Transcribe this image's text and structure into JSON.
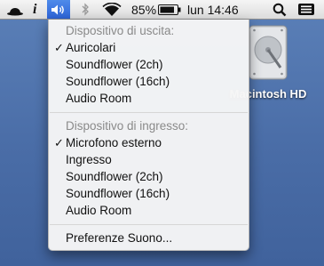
{
  "menubar": {
    "battery_percent": "85%",
    "datetime": "lun 14:46"
  },
  "volume_menu": {
    "output_header": "Dispositivo di uscita:",
    "output_devices": [
      {
        "label": "Auricolari",
        "checked": true
      },
      {
        "label": "Soundflower (2ch)",
        "checked": false
      },
      {
        "label": "Soundflower (16ch)",
        "checked": false
      },
      {
        "label": "Audio Room",
        "checked": false
      }
    ],
    "input_header": "Dispositivo di ingresso:",
    "input_devices": [
      {
        "label": "Microfono esterno",
        "checked": true
      },
      {
        "label": "Ingresso",
        "checked": false
      },
      {
        "label": "Soundflower (2ch)",
        "checked": false
      },
      {
        "label": "Soundflower (16ch)",
        "checked": false
      },
      {
        "label": "Audio Room",
        "checked": false
      }
    ],
    "preferences_label": "Preferenze Suono...",
    "check_glyph": "✓"
  },
  "desktop": {
    "disk_label": "Macintosh HD"
  },
  "icons": [
    "bowler-hat-icon",
    "info-icon",
    "volume-icon",
    "bluetooth-icon",
    "wifi-icon",
    "battery-icon",
    "spotlight-search-icon",
    "list-menu-icon",
    "hard-disk-icon"
  ],
  "colors": {
    "menubar_highlight": "#3a6fdf",
    "desktop": "#4a6fa8",
    "menu_bg": "#f6f6f6",
    "header_text": "#8a8a8a"
  }
}
